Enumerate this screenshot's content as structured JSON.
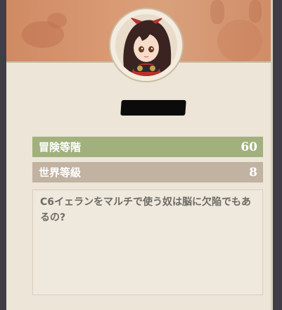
{
  "profile": {
    "adventure_rank_label": "冒険等階",
    "adventure_rank_value": "60",
    "world_level_label": "世界等級",
    "world_level_value": "8",
    "signature": "C6イェランをマルチで使う奴は脳に欠陥でもあるの?"
  },
  "colors": {
    "card_bg": "#ece5d8",
    "banner": "#d99a74",
    "adventure_row": "#a2b07e",
    "world_row": "#c1b2a1",
    "signature_text": "#6d6b66"
  },
  "icons": {
    "avatar": "character-avatar-icon"
  }
}
